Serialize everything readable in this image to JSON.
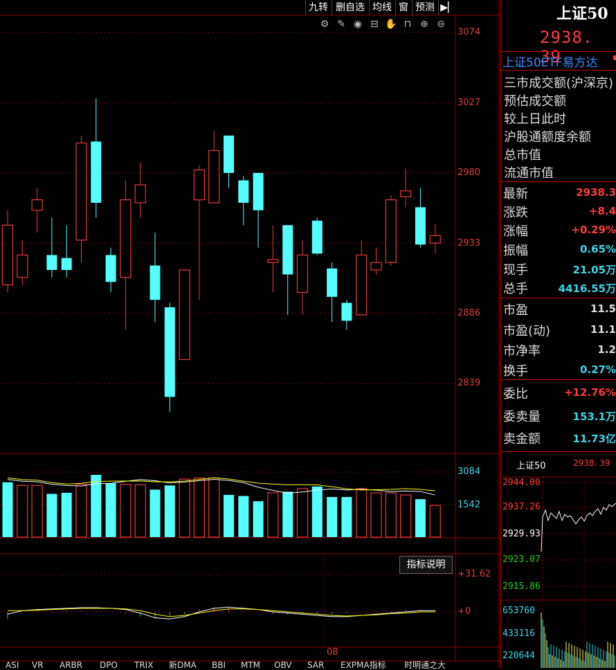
{
  "toolbar": {
    "buttons": [
      "九转",
      "删自选",
      "均线",
      "窗",
      "预测"
    ],
    "icons": [
      "gear-icon",
      "pencil-icon",
      "eye-icon",
      "lock-icon",
      "hand-icon",
      "unlock-icon",
      "zoom-in-icon",
      "zoom-out-icon"
    ]
  },
  "axes": {
    "price_labels": [
      "3074",
      "3027",
      "2980",
      "2933",
      "2886",
      "2839"
    ],
    "volume_labels": [
      "3084",
      "1542"
    ],
    "indicator_labels": [
      "+31.62",
      "+0"
    ],
    "date_label": "08"
  },
  "indicator_button": "指标说明",
  "right_panel": {
    "title": "上证50",
    "price": "2938. 39",
    "fund": "上证50ETF易方达",
    "info_rows": [
      "三市成交额(沪深京)",
      "预估成交额",
      "较上日此时",
      "沪股通额度余额",
      "总市值",
      "流通市值"
    ],
    "quote_rows": [
      {
        "label": "最新",
        "value": "2938.3",
        "color": "red"
      },
      {
        "label": "涨跌",
        "value": "+8.4",
        "color": "red"
      },
      {
        "label": "涨幅",
        "value": "+0.29%",
        "color": "red"
      },
      {
        "label": "振幅",
        "value": "0.65%",
        "color": "cyan"
      },
      {
        "label": "现手",
        "value": "21.05万",
        "color": "cyan"
      },
      {
        "label": "总手",
        "value": "4416.55万",
        "color": "cyan"
      }
    ],
    "val_rows": [
      {
        "label": "市盈",
        "value": "11.5",
        "color": "white"
      },
      {
        "label": "市盈(动)",
        "value": "11.1",
        "color": "white"
      },
      {
        "label": "市净率",
        "value": "1.2",
        "color": "white"
      },
      {
        "label": "换手",
        "value": "0.27%",
        "color": "cyan"
      }
    ],
    "order_rows": [
      {
        "label": "委比",
        "value": "+12.76%",
        "color": "red"
      },
      {
        "label": "委卖量",
        "value": "153.1万",
        "color": "cyan"
      },
      {
        "label": "卖金额",
        "value": "11.73亿",
        "color": "cyan"
      }
    ]
  },
  "mini_chart": {
    "title": "上证50",
    "price": "2938. 39",
    "price_labels": [
      "2944.00",
      "2937.26",
      "2929.93",
      "2923.07",
      "2915.86"
    ],
    "volume_labels": [
      "653760",
      "433116",
      "220644"
    ]
  },
  "bottom_tabs": [
    "ASI",
    "VR",
    "ARBR",
    "DPO",
    "TRIX",
    "新DMA",
    "BBI",
    "MTM",
    "OBV",
    "SAR",
    "EXPMA指标",
    "时明通之大"
  ],
  "chart_data": {
    "type": "candlestick",
    "ylim": [
      2820,
      3090
    ],
    "candles": [
      {
        "o": 2905,
        "c": 2945,
        "h": 2955,
        "l": 2900
      },
      {
        "o": 2910,
        "c": 2925,
        "h": 2935,
        "l": 2905
      },
      {
        "o": 2955,
        "c": 2962,
        "h": 2970,
        "l": 2940
      },
      {
        "o": 2925,
        "c": 2915,
        "h": 2950,
        "l": 2910
      },
      {
        "o": 2923,
        "c": 2915,
        "h": 2945,
        "l": 2910
      },
      {
        "o": 2935,
        "c": 3000,
        "h": 3005,
        "l": 2920
      },
      {
        "o": 3001,
        "c": 2960,
        "h": 3030,
        "l": 2950
      },
      {
        "o": 2925,
        "c": 2907,
        "h": 2930,
        "l": 2900
      },
      {
        "o": 2910,
        "c": 2962,
        "h": 2975,
        "l": 2875
      },
      {
        "o": 2960,
        "c": 2972,
        "h": 2987,
        "l": 2950
      },
      {
        "o": 2918,
        "c": 2895,
        "h": 2940,
        "l": 2880
      },
      {
        "o": 2890,
        "c": 2830,
        "h": 2893,
        "l": 2820
      },
      {
        "o": 2855,
        "c": 2915,
        "h": 2915,
        "l": 2855
      },
      {
        "o": 2962,
        "c": 2982,
        "h": 2985,
        "l": 2895
      },
      {
        "o": 2960,
        "c": 2995,
        "h": 3008,
        "l": 2960
      },
      {
        "o": 3005,
        "c": 2980,
        "h": 3005,
        "l": 2970
      },
      {
        "o": 2975,
        "c": 2960,
        "h": 2978,
        "l": 2945
      },
      {
        "o": 2980,
        "c": 2955,
        "h": 2980,
        "l": 2930
      },
      {
        "o": 2920,
        "c": 2922,
        "h": 2945,
        "l": 2900
      },
      {
        "o": 2945,
        "c": 2912,
        "h": 2945,
        "l": 2885
      },
      {
        "o": 2900,
        "c": 2925,
        "h": 2935,
        "l": 2885
      },
      {
        "o": 2948,
        "c": 2926,
        "h": 2950,
        "l": 2925
      },
      {
        "o": 2916,
        "c": 2897,
        "h": 2920,
        "l": 2880
      },
      {
        "o": 2893,
        "c": 2881,
        "h": 2895,
        "l": 2875
      },
      {
        "o": 2885,
        "c": 2925,
        "h": 2935,
        "l": 2885
      },
      {
        "o": 2915,
        "c": 2920,
        "h": 2930,
        "l": 2912
      },
      {
        "o": 2920,
        "c": 2962,
        "h": 2965,
        "l": 2918
      },
      {
        "o": 2964,
        "c": 2968,
        "h": 2983,
        "l": 2957
      },
      {
        "o": 2957,
        "c": 2932,
        "h": 2970,
        "l": 2930
      },
      {
        "o": 2933,
        "c": 2938,
        "h": 2946,
        "l": 2926
      }
    ],
    "volume_ylim": [
      0,
      3300
    ],
    "volumes": [
      {
        "v": 2600,
        "up": false
      },
      {
        "v": 2450,
        "up": true
      },
      {
        "v": 2450,
        "up": true
      },
      {
        "v": 2050,
        "up": false
      },
      {
        "v": 2100,
        "up": false
      },
      {
        "v": 2500,
        "up": true
      },
      {
        "v": 2950,
        "up": false
      },
      {
        "v": 2550,
        "up": false
      },
      {
        "v": 2500,
        "up": true
      },
      {
        "v": 2480,
        "up": true
      },
      {
        "v": 2250,
        "up": false
      },
      {
        "v": 2450,
        "up": false
      },
      {
        "v": 2750,
        "up": true
      },
      {
        "v": 2800,
        "up": true
      },
      {
        "v": 2800,
        "up": true
      },
      {
        "v": 2000,
        "up": false
      },
      {
        "v": 1950,
        "up": false
      },
      {
        "v": 1700,
        "up": false
      },
      {
        "v": 2100,
        "up": true
      },
      {
        "v": 2150,
        "up": false
      },
      {
        "v": 2300,
        "up": true
      },
      {
        "v": 2400,
        "up": false
      },
      {
        "v": 1900,
        "up": false
      },
      {
        "v": 1900,
        "up": false
      },
      {
        "v": 2300,
        "up": true
      },
      {
        "v": 2100,
        "up": true
      },
      {
        "v": 2100,
        "up": true
      },
      {
        "v": 2000,
        "up": true
      },
      {
        "v": 1800,
        "up": false
      },
      {
        "v": 1500,
        "up": true
      }
    ],
    "indicator": {
      "ylim": [
        -40,
        40
      ],
      "line1": [
        -2,
        1,
        2,
        2.5,
        3,
        3.5,
        3.5,
        3,
        2,
        -1,
        -5,
        -6,
        -4,
        0,
        3,
        4,
        3,
        2,
        0,
        -1,
        -2,
        -3,
        -4,
        -4,
        -3,
        -2,
        -1,
        0,
        1,
        1
      ],
      "line2": [
        1,
        1,
        1.5,
        2,
        2.5,
        3,
        3,
        3,
        2.5,
        1,
        -2,
        -4,
        -3,
        -1,
        1,
        2.5,
        2.5,
        2,
        1,
        0,
        -1,
        -2,
        -3,
        -3.5,
        -3,
        -2.5,
        -1.5,
        -1,
        0,
        0
      ]
    }
  }
}
